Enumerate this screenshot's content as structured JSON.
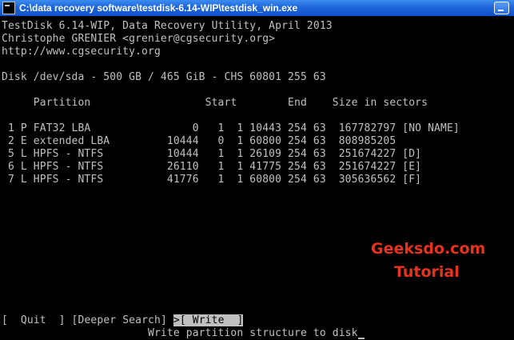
{
  "window": {
    "title": "C:\\data recovery software\\testdisk-6.14-WIP\\testdisk_win.exe"
  },
  "header": {
    "line1": "TestDisk 6.14-WIP, Data Recovery Utility, April 2013",
    "line2": "Christophe GRENIER <grenier@cgsecurity.org>",
    "line3": "http://www.cgsecurity.org"
  },
  "disk": {
    "info": "Disk /dev/sda - 500 GB / 465 GiB - CHS 60801 255 63"
  },
  "table": {
    "header": "     Partition                  Start        End    Size in sectors",
    "rows": [
      " 1 P FAT32 LBA                0   1  1 10443 254 63  167782797 [NO NAME]",
      " 2 E extended LBA         10444   0  1 60800 254 63  808985205",
      " 5 L HPFS - NTFS          10444   1  1 26109 254 63  251674227 [D]",
      " 6 L HPFS - NTFS          26110   1  1 41775 254 63  251674227 [E]",
      " 7 L HPFS - NTFS          41776   1  1 60800 254 63  305636562 [F]"
    ]
  },
  "menu": {
    "quit": "[  Quit  ]",
    "deeper": "[Deeper Search]",
    "write": ">[ Write  ]",
    "hint": "Write partition structure to disk"
  },
  "watermark": {
    "site": "Geeksdo.com",
    "tagline": "Tutorial"
  }
}
